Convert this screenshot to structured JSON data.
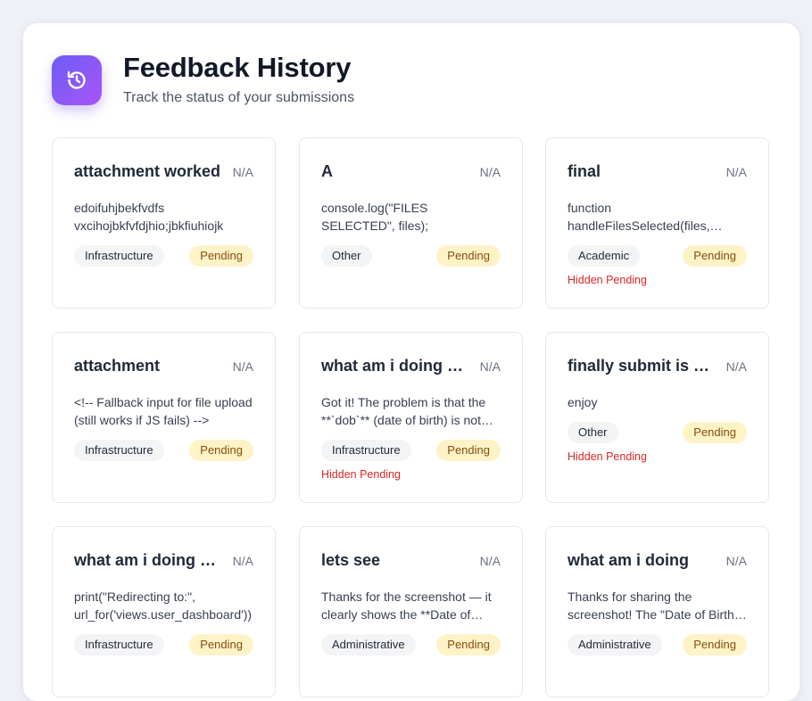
{
  "header": {
    "title": "Feedback History",
    "subtitle": "Track the status of your submissions",
    "icon": "history-icon"
  },
  "colors": {
    "accent_start": "#6d5cf5",
    "accent_end": "#a855f7",
    "pending_bg": "#fef3c7",
    "pending_text": "#854d0e",
    "hidden_pending": "#dc2626"
  },
  "feedback": [
    {
      "title": "attachment worked",
      "date": "N/A",
      "description": "edoifuhjbekfvdfs vxcihojbkfvfdjhio;jbkfiuhiojk",
      "category": "Infrastructure",
      "status": "Pending",
      "hidden_status": ""
    },
    {
      "title": "A",
      "date": "N/A",
      "description": "console.log(\"FILES SELECTED\", files);",
      "category": "Other",
      "status": "Pending",
      "hidden_status": ""
    },
    {
      "title": "final",
      "date": "N/A",
      "description": "function handleFilesSelected(files, inputElement) {",
      "category": "Academic",
      "status": "Pending",
      "hidden_status": "Hidden Pending"
    },
    {
      "title": "attachment",
      "date": "N/A",
      "description": "<!-- Fallback input for file upload (still works if JS fails) -->",
      "category": "Infrastructure",
      "status": "Pending",
      "hidden_status": ""
    },
    {
      "title": "what am i doing again",
      "date": "N/A",
      "description": "Got it! The problem is that the **`dob`** (date of birth) is not being saved",
      "category": "Infrastructure",
      "status": "Pending",
      "hidden_status": "Hidden Pending"
    },
    {
      "title": "finally submit is done",
      "date": "N/A",
      "description": "enjoy",
      "category": "Other",
      "status": "Pending",
      "hidden_status": "Hidden Pending"
    },
    {
      "title": "what am i doing again",
      "date": "N/A",
      "description": "print(\"Redirecting to:\", url_for('views.user_dashboard'))",
      "category": "Infrastructure",
      "status": "Pending",
      "hidden_status": ""
    },
    {
      "title": "lets see",
      "date": "N/A",
      "description": "Thanks for the screenshot — it clearly shows the **Date of Birth** field",
      "category": "Administrative",
      "status": "Pending",
      "hidden_status": ""
    },
    {
      "title": "what am i doing",
      "date": "N/A",
      "description": "Thanks for sharing the screenshot! The \"Date of Birth\" field",
      "category": "Administrative",
      "status": "Pending",
      "hidden_status": ""
    }
  ]
}
